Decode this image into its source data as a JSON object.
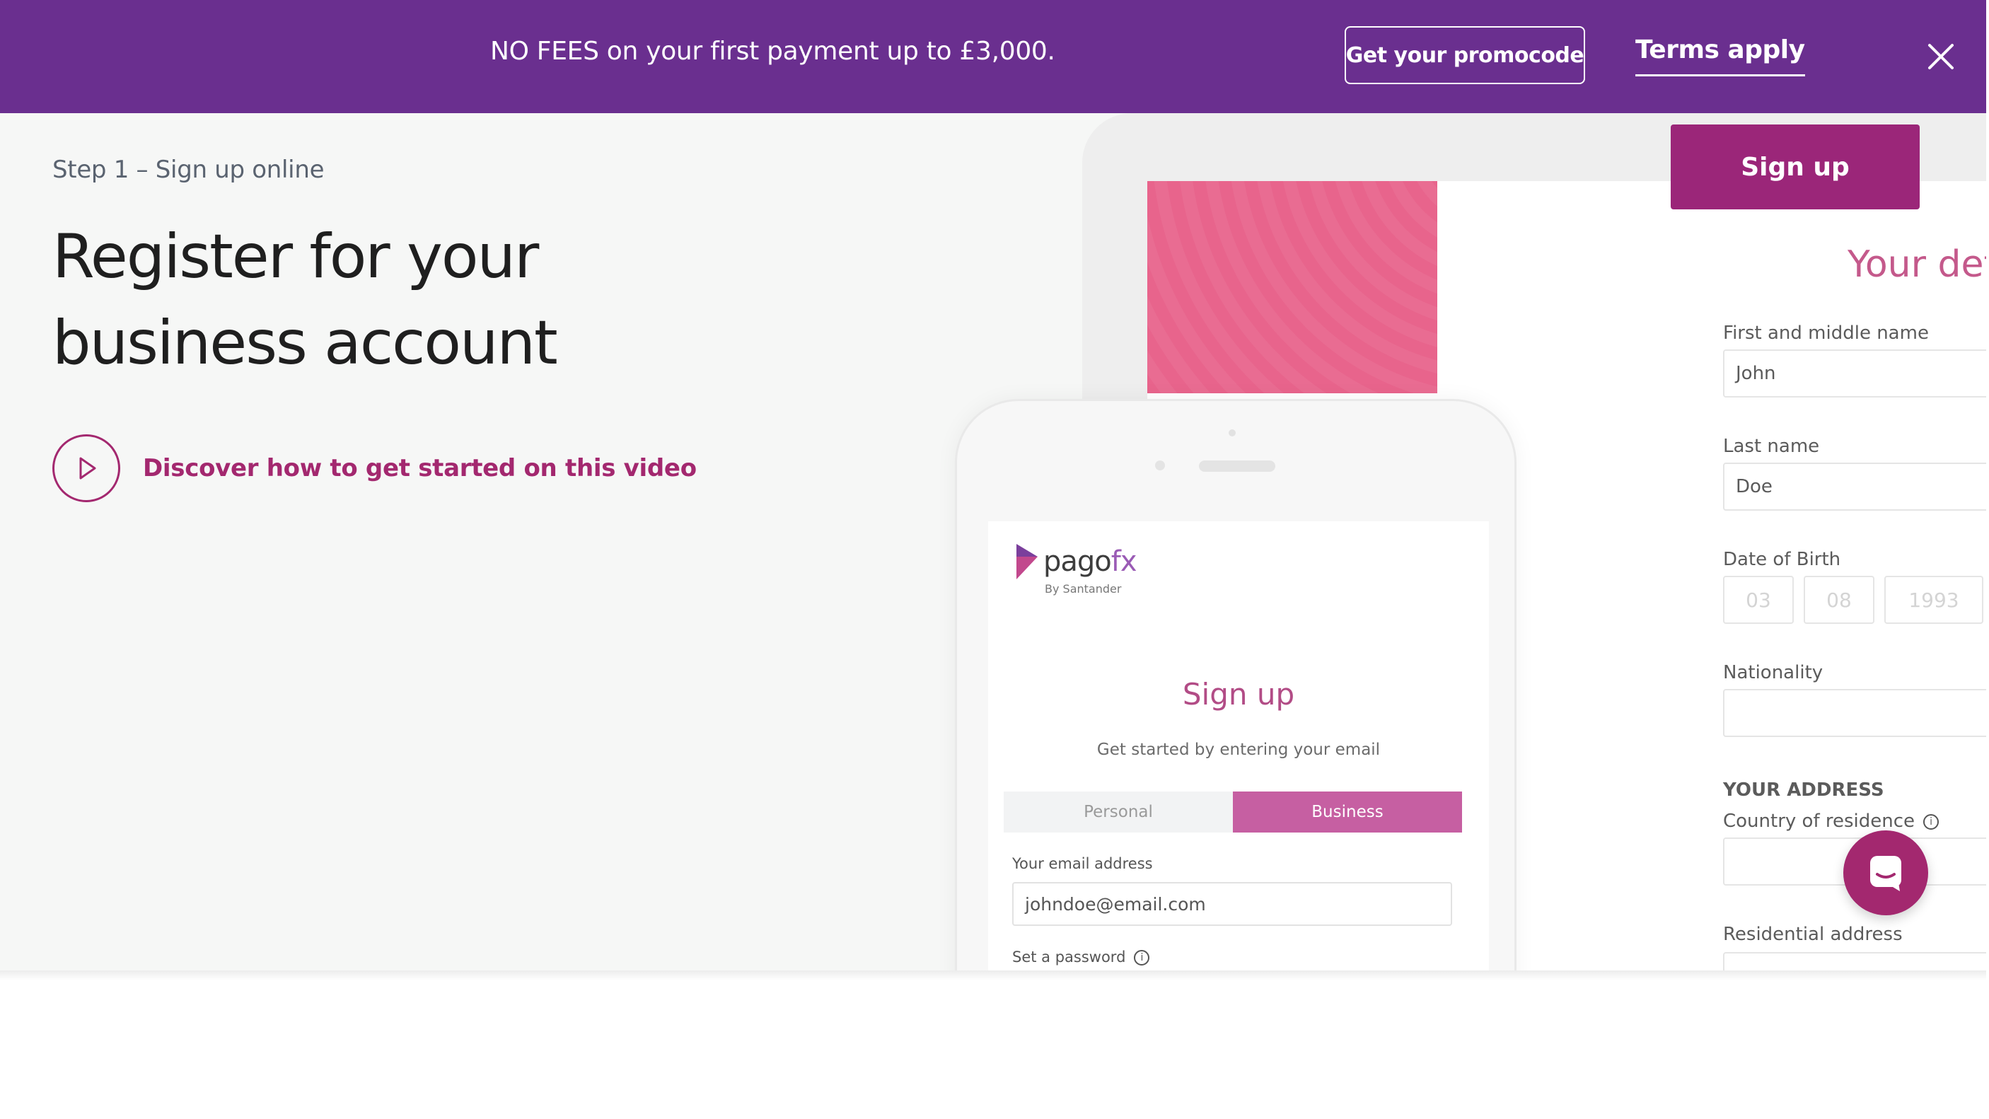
{
  "banner": {
    "promo_text": "NO FEES on your first payment up to £3,000.",
    "promo_button": "Get your promocode",
    "terms_link": "Terms apply",
    "close_icon": "close-icon"
  },
  "header": {
    "signup_button": "Sign up"
  },
  "hero": {
    "step_label": "Step 1 – Sign up online",
    "title": "Register for your business account",
    "video_link": "Discover how to get started on this video",
    "play_icon": "play-icon"
  },
  "phone_mockup": {
    "logo_word": "pago",
    "logo_fx": "fx",
    "logo_byline": "By Santander",
    "title": "Sign up",
    "subtitle": "Get started by entering your email",
    "toggle_personal": "Personal",
    "toggle_business": "Business",
    "email_label": "Your email address",
    "email_value": "johndoe@email.com",
    "password_label": "Set a password"
  },
  "tablet_form": {
    "title": "Your det",
    "first_name_label": "First and middle name",
    "first_name_value": "John",
    "last_name_label": "Last name",
    "last_name_value": "Doe",
    "dob_label": "Date of Birth",
    "dob_day": "03",
    "dob_month": "08",
    "dob_year": "1993",
    "nationality_label": "Nationality",
    "address_section": "YOUR ADDRESS",
    "country_label": "Country of residence",
    "residential_label": "Residential address"
  },
  "colors": {
    "banner_bg": "#6a2f8f",
    "accent": "#a3286f",
    "signup_bg": "#9b2679",
    "page_bg": "#f6f7f6"
  },
  "chat": {
    "icon": "chat-icon"
  }
}
